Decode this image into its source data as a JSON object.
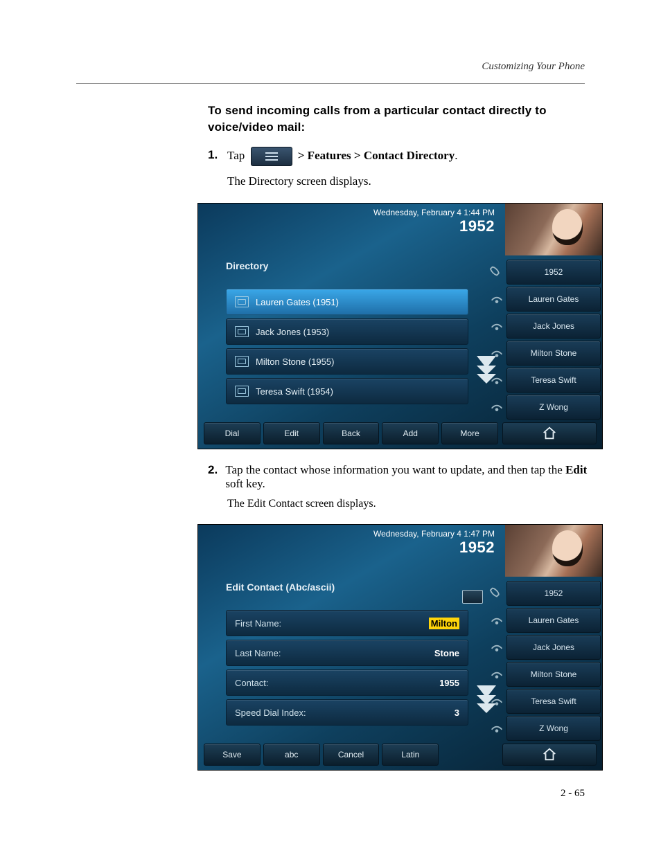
{
  "header": {
    "section": "Customizing Your Phone"
  },
  "intro": "To send incoming calls from a particular contact directly to voice/video mail:",
  "steps": {
    "s1_num": "1.",
    "s1_tap": "Tap",
    "s1_path": " > Features > Contact Directory",
    "s1_period": ".",
    "s1_result": "The Directory screen displays.",
    "s2_num": "2.",
    "s2_a": "Tap the contact whose information you want to update, and then tap the ",
    "s2_bold": "Edit",
    "s2_b": " soft key.",
    "s2_result": "The Edit Contact screen displays."
  },
  "shot1": {
    "datetime": "Wednesday, February 4  1:44 PM",
    "ext": "1952",
    "title": "Directory",
    "rows": [
      "Lauren Gates (1951)",
      "Jack Jones (1953)",
      "Milton Stone (1955)",
      "Teresa Swift (1954)"
    ],
    "softkeys": [
      "Dial",
      "Edit",
      "Back",
      "Add",
      "More"
    ],
    "sidebar": [
      "1952",
      "Lauren Gates",
      "Jack Jones",
      "Milton Stone",
      "Teresa Swift",
      "Z Wong"
    ]
  },
  "shot2": {
    "datetime": "Wednesday, February 4  1:47 PM",
    "ext": "1952",
    "title": "Edit Contact (Abc/ascii)",
    "fields": [
      {
        "label": "First Name:",
        "value": "Milton",
        "hl": true
      },
      {
        "label": "Last Name:",
        "value": "Stone",
        "hl": false
      },
      {
        "label": "Contact:",
        "value": "1955",
        "hl": false
      },
      {
        "label": "Speed Dial Index:",
        "value": "3",
        "hl": false
      }
    ],
    "softkeys": [
      "Save",
      "abc",
      "Cancel",
      "Latin"
    ],
    "sidebar": [
      "1952",
      "Lauren Gates",
      "Jack Jones",
      "Milton Stone",
      "Teresa Swift",
      "Z Wong"
    ]
  },
  "footer": {
    "page": "2 - 65"
  }
}
